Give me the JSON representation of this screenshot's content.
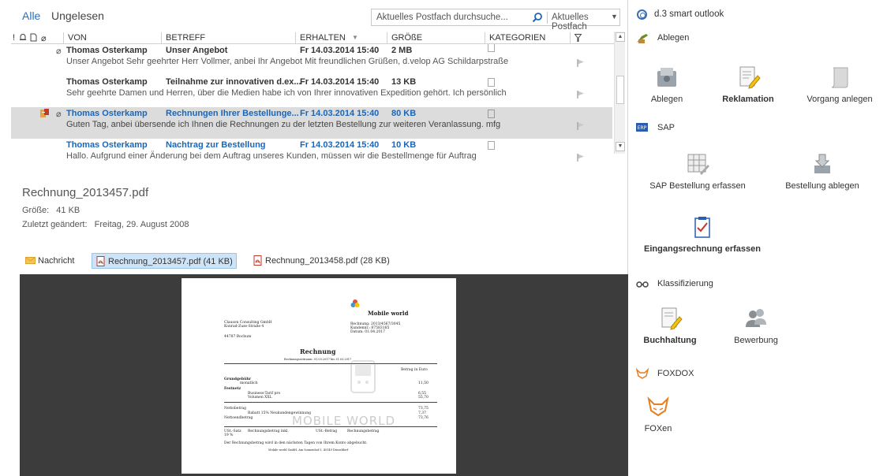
{
  "filter": {
    "all": "Alle",
    "unread": "Ungelesen"
  },
  "search": {
    "placeholder": "Aktuelles Postfach durchsuche...",
    "scope": "Aktuelles Postfach"
  },
  "columns": {
    "icons": "!",
    "from": "VON",
    "subject": "BETREFF",
    "received": "ERHALTEN",
    "size": "GRÖßE",
    "categories": "KATEGORIEN"
  },
  "messages": [
    {
      "from": "Thomas Osterkamp",
      "subject": "Unser Angebot",
      "received": "Fr 14.03.2014 15:40",
      "size": "2 MB",
      "preview": "Unser Angebot  Sehr geehrter Herr Vollmer,  anbei Ihr Angebot  Mit freundlichen Grüßen,  d.velop AG  Schildarpstraße",
      "selected": false,
      "unread": false,
      "attachment": true
    },
    {
      "from": "Thomas Osterkamp",
      "subject": "Teilnahme zur innovativen d.ex...",
      "received": "Fr 14.03.2014 15:40",
      "size": "13 KB",
      "preview": "Sehr geehrte Damen und Herren,  über die Medien habe ich von Ihrer innovativen Expedition gehört. Ich persönlich",
      "selected": false,
      "unread": false,
      "attachment": false
    },
    {
      "from": "Thomas Osterkamp",
      "subject": "Rechnungen Ihrer Bestellunge...",
      "received": "Fr 14.03.2014 15:40",
      "size": "80 KB",
      "preview": "Guten Tag,  anbei übersende ich Ihnen die Rechnungen zu der letzten Bestellung zur weiteren Veranlassung.  mfg",
      "selected": true,
      "unread": true,
      "attachment": true
    },
    {
      "from": "Thomas Osterkamp",
      "subject": "Nachtrag zur Bestellung",
      "received": "Fr 14.03.2014 15:40",
      "size": "10 KB",
      "preview": "Hallo.  Aufgrund einer Änderung bei dem Auftrag unseres Kunden, müssen wir die Bestellmenge für Auftrag",
      "selected": false,
      "unread": true,
      "attachment": false
    }
  ],
  "reading": {
    "file_title": "Rechnung_2013457.pdf",
    "size_label": "Größe:",
    "size_value": "41 KB",
    "modified_label": "Zuletzt geändert:",
    "modified_value": "Freitag, 29. August 2008"
  },
  "tabs": [
    {
      "label": "Nachricht",
      "active": false
    },
    {
      "label": "Rechnung_2013457.pdf (41 KB)",
      "active": true
    },
    {
      "label": "Rechnung_2013458.pdf (28 KB)",
      "active": false
    }
  ],
  "document": {
    "brand": "Mobile world",
    "sender_line1": "Clauson Consulting GmbH",
    "sender_line2": "Konrad-Zuse-Straße 4",
    "sender_line3": "44787 Bochum",
    "inv_no": "Rechnung: 2013/4567/3045",
    "cust_no": "Kundennr.: 87583165",
    "date": "Datum: 01.04.2017",
    "heading": "Rechnung",
    "subheading": "Rechnungszeitraum: 01.03.2017 bis 31.03.2017",
    "currency": "Betrag in Euro",
    "row1_label": "Grundgebühr",
    "row1_sub": "monatlich",
    "row1_val": "11,50",
    "row2_label": "Festnetz",
    "row2_sub1": "Business-Tarif pro",
    "row2_sub2": "Volumen XXL",
    "row2_val1": "6,55",
    "row2_val2": "55,70",
    "net_label": "Nettobetrag",
    "discount_label": "Rabatt 15% Neukundengewinnung",
    "net_after": "Nettoendbetrag",
    "net_val": "73,75",
    "disc_val": "7,37",
    "net_after_val": "73,76",
    "watermark": "MOBILE WORLD",
    "vat_label": "USt.-Satz",
    "vat_rate": "19 %",
    "vat_base_label": "Rechnungsbetrag inkl.",
    "vat_amt_label": "USt.-Betrag",
    "total_label": "Rechnungsbetrag",
    "footer1": "Der Rechnungsbetrag wird in den nächsten Tagen von Ihrem Konto abgebucht.",
    "footer2": "Mobile world GmbH, Am Sonnenhof 5, 45149 Düsseldorf"
  },
  "panel": {
    "title": "d.3 smart outlook",
    "sections": [
      {
        "label": "Ablegen",
        "actions": [
          "Ablegen",
          "Reklamation",
          "Vorgang anlegen"
        ]
      },
      {
        "label": "SAP",
        "actions": [
          "SAP Bestellung erfassen",
          "Bestellung ablegen",
          "Eingangsrechnung erfassen"
        ]
      },
      {
        "label": "Klassifizierung",
        "actions": [
          "Buchhaltung",
          "Bewerbung"
        ]
      },
      {
        "label": "FOXDOX",
        "actions": [
          "FOXen"
        ]
      }
    ]
  },
  "colors": {
    "accent": "#2a6ebb",
    "unread_text": "#1a66b8",
    "selected_row": "#dcdcdc",
    "viewer_bg": "#3c3c3c",
    "active_tab": "#cde3f7"
  }
}
